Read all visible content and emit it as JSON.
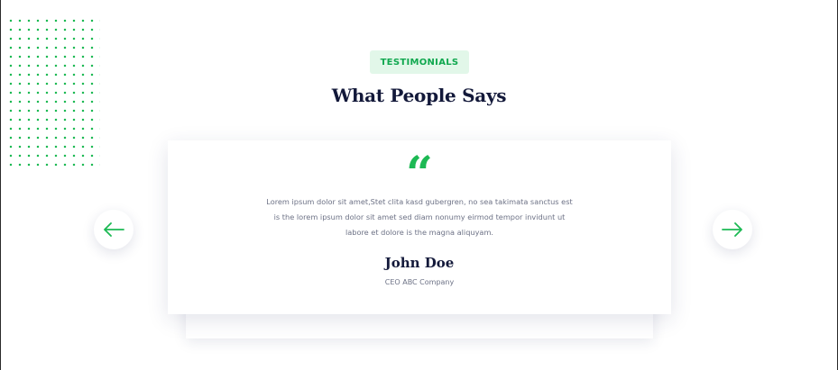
{
  "section": {
    "badge": "TESTIMONIALS",
    "title": "What People Says"
  },
  "testimonial": {
    "quote_mark": "“",
    "text": "Lorem ipsum dolor sit amet,Stet clita kasd gubergren, no sea takimata sanctus est is the lorem ipsum dolor sit amet sed diam nonumy eirmod tempor invidunt ut labore et dolore is the magna aliquyam.",
    "name": "John Doe",
    "role": "CEO ABC Company"
  },
  "navigation": {
    "prev_icon": "arrow-left-icon",
    "next_icon": "arrow-right-icon"
  },
  "colors": {
    "accent": "#1db954",
    "badge_bg": "#e2f7e9",
    "heading": "#13193a",
    "body_text": "#6d7286"
  }
}
